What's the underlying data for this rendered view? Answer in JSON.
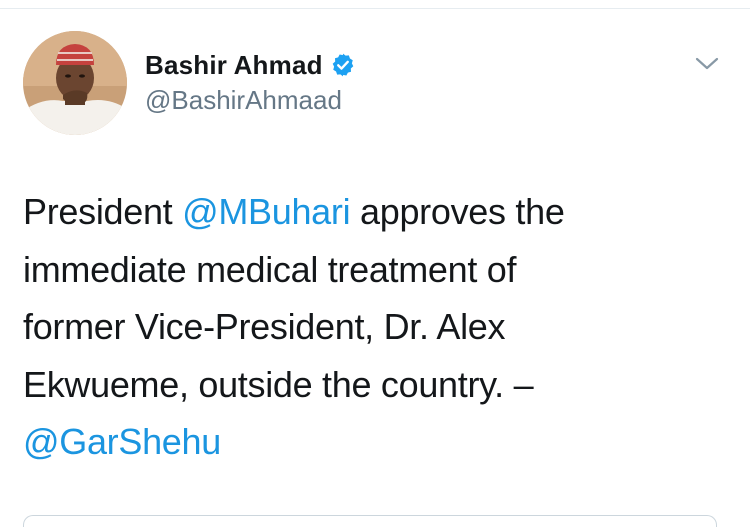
{
  "author": {
    "display_name": "Bashir Ahmad",
    "handle": "@BashirAhmaad",
    "verified": true,
    "avatar_icon": "profile-photo"
  },
  "tweet": {
    "line1_pre": "President ",
    "line1_mention": "@MBuhari",
    "line1_post": " approves the",
    "line2": "immediate medical treatment of",
    "line3": "former Vice-President, Dr. Alex",
    "line4": "Ekwueme, outside the country. –",
    "line5_mention": "@GarShehu"
  },
  "menu": {
    "icon": "chevron-down-icon"
  },
  "colors": {
    "link": "#1b95e0",
    "verified": "#1da1f2",
    "secondary_text": "#657786",
    "primary_text": "#14171a"
  }
}
